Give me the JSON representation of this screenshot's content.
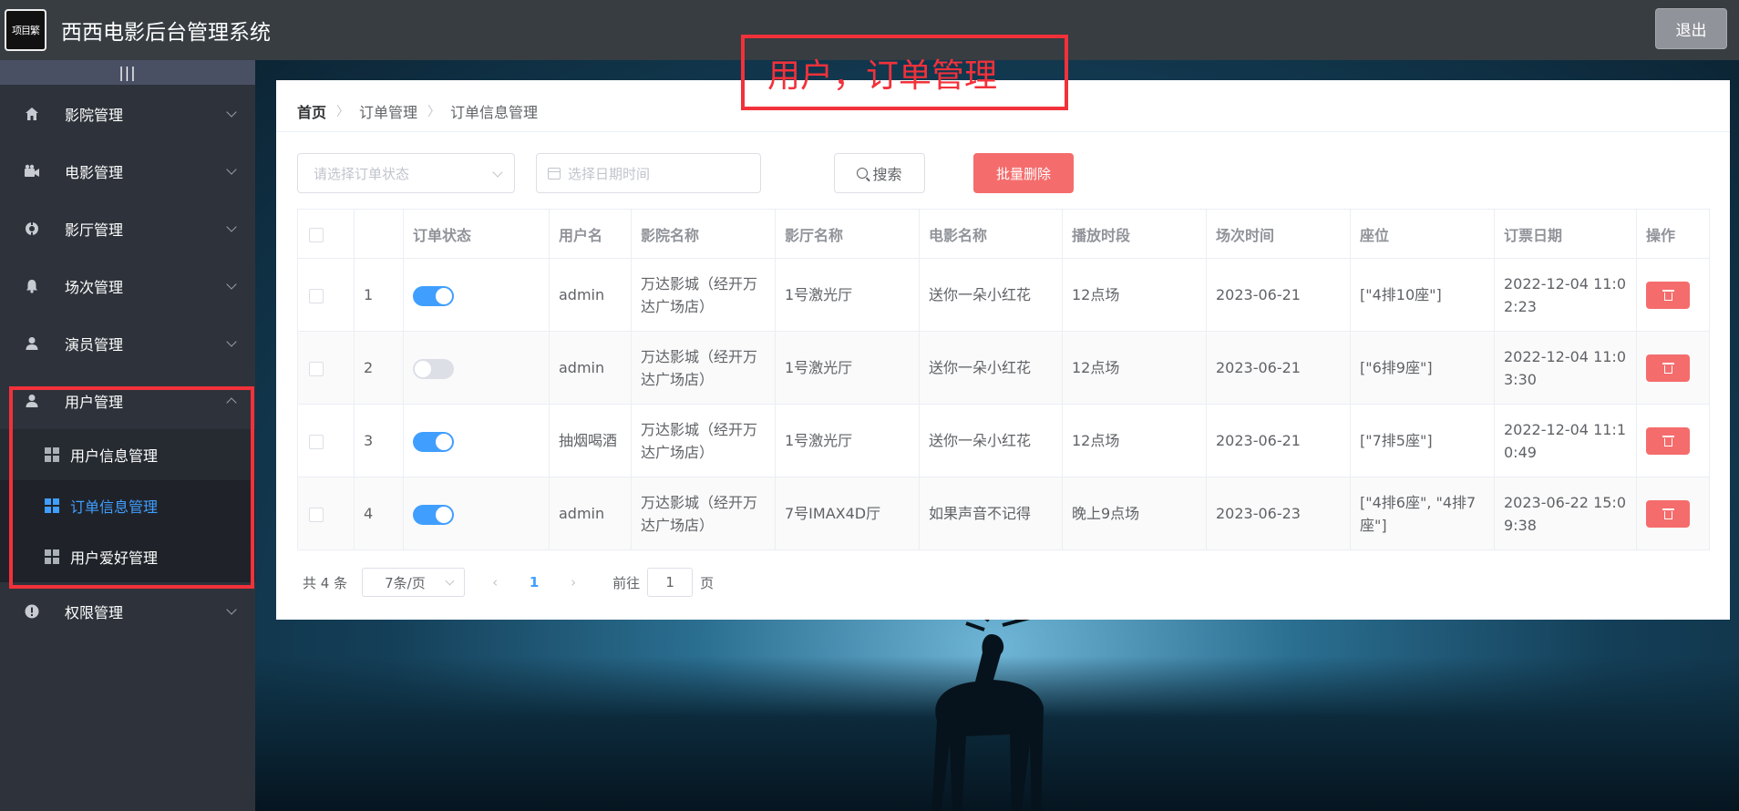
{
  "header": {
    "logo_text": "项目繁",
    "title": "西西电影后台管理系统",
    "logout_label": "退出"
  },
  "sidebar": {
    "collapse_label": "|||",
    "menu": [
      {
        "label": "影院管理",
        "icon": "home-icon"
      },
      {
        "label": "电影管理",
        "icon": "camera-icon"
      },
      {
        "label": "影厅管理",
        "icon": "compass-icon"
      },
      {
        "label": "场次管理",
        "icon": "bell-icon"
      },
      {
        "label": "演员管理",
        "icon": "user-icon"
      },
      {
        "label": "用户管理",
        "icon": "user-icon",
        "expanded": true
      }
    ],
    "submenu": [
      {
        "label": "用户信息管理"
      },
      {
        "label": "订单信息管理",
        "active": true
      },
      {
        "label": "用户爱好管理"
      }
    ],
    "last_menu": {
      "label": "权限管理",
      "icon": "warning-icon"
    }
  },
  "annotation": {
    "title_box": "用户，订单管理"
  },
  "breadcrumb": {
    "home": "首页",
    "level1": "订单管理",
    "level2": "订单信息管理"
  },
  "filters": {
    "status_placeholder": "请选择订单状态",
    "date_placeholder": "选择日期时间",
    "search_label": "搜索",
    "batch_delete_label": "批量删除"
  },
  "table": {
    "headers": [
      "",
      "",
      "订单状态",
      "用户名",
      "影院名称",
      "影厅名称",
      "电影名称",
      "播放时段",
      "场次时间",
      "座位",
      "订票日期",
      "操作"
    ],
    "rows": [
      {
        "index": "1",
        "status_on": true,
        "user": "admin",
        "cinema": "万达影城（经开万达广场店）",
        "hall": "1号激光厅",
        "movie": "送你一朵小红花",
        "period": "12点场",
        "session": "2023-06-21",
        "seat": "[\"4排10座\"]",
        "order_date": "2022-12-04 11:02:23"
      },
      {
        "index": "2",
        "status_on": false,
        "user": "admin",
        "cinema": "万达影城（经开万达广场店）",
        "hall": "1号激光厅",
        "movie": "送你一朵小红花",
        "period": "12点场",
        "session": "2023-06-21",
        "seat": "[\"6排9座\"]",
        "order_date": "2022-12-04 11:03:30"
      },
      {
        "index": "3",
        "status_on": true,
        "user": "抽烟喝酒",
        "cinema": "万达影城（经开万达广场店）",
        "hall": "1号激光厅",
        "movie": "送你一朵小红花",
        "period": "12点场",
        "session": "2023-06-21",
        "seat": "[\"7排5座\"]",
        "order_date": "2022-12-04 11:10:49"
      },
      {
        "index": "4",
        "status_on": true,
        "user": "admin",
        "cinema": "万达影城（经开万达广场店）",
        "hall": "7号IMAX4D厅",
        "movie": "如果声音不记得",
        "period": "晚上9点场",
        "session": "2023-06-23",
        "seat": "[\"4排6座\", \"4排7座\"]",
        "order_date": "2023-06-22 15:09:38"
      }
    ]
  },
  "pagination": {
    "total": "共 4 条",
    "page_size": "7条/页",
    "current_page": "1",
    "goto_label": "前往",
    "goto_value": "1",
    "page_suffix": "页"
  },
  "colors": {
    "accent": "#409eff",
    "danger": "#f56c6c",
    "annotation_red": "#f2313a",
    "sidebar_bg": "#2e333b"
  }
}
